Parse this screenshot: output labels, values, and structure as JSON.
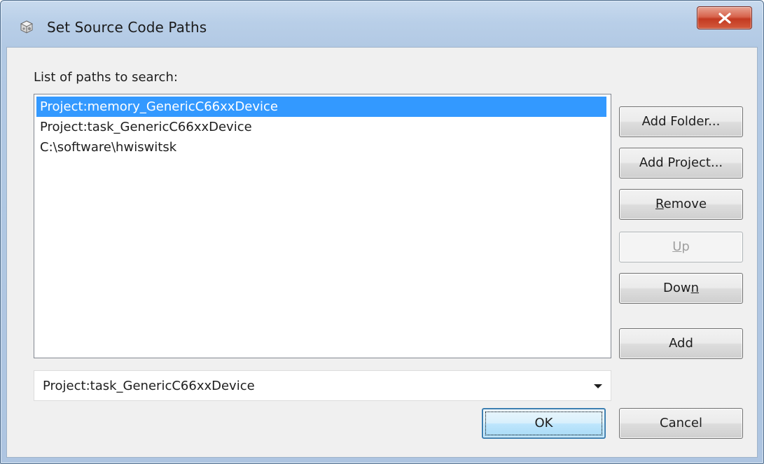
{
  "window": {
    "title": "Set Source Code Paths",
    "icon": "gear-cube-icon",
    "close_icon": "close-icon"
  },
  "paths": {
    "label": "List of paths to search:",
    "items": [
      {
        "label": "Project:memory_GenericC66xxDevice",
        "selected": true
      },
      {
        "label": "Project:task_GenericC66xxDevice",
        "selected": false
      },
      {
        "label": "C:\\software\\hwiswitsk",
        "selected": false
      }
    ]
  },
  "buttons": {
    "add_folder": "Add Folder...",
    "add_project": "Add Project...",
    "remove": "Remove",
    "up": "Up",
    "down": "Down",
    "add": "Add",
    "ok": "OK",
    "cancel": "Cancel"
  },
  "combo": {
    "value": "Project:task_GenericC66xxDevice"
  },
  "colors": {
    "selection": "#3399ff",
    "title_bar": "#b9cfe8",
    "close_button": "#c33a22",
    "dialog_background": "#f0f0f0"
  }
}
